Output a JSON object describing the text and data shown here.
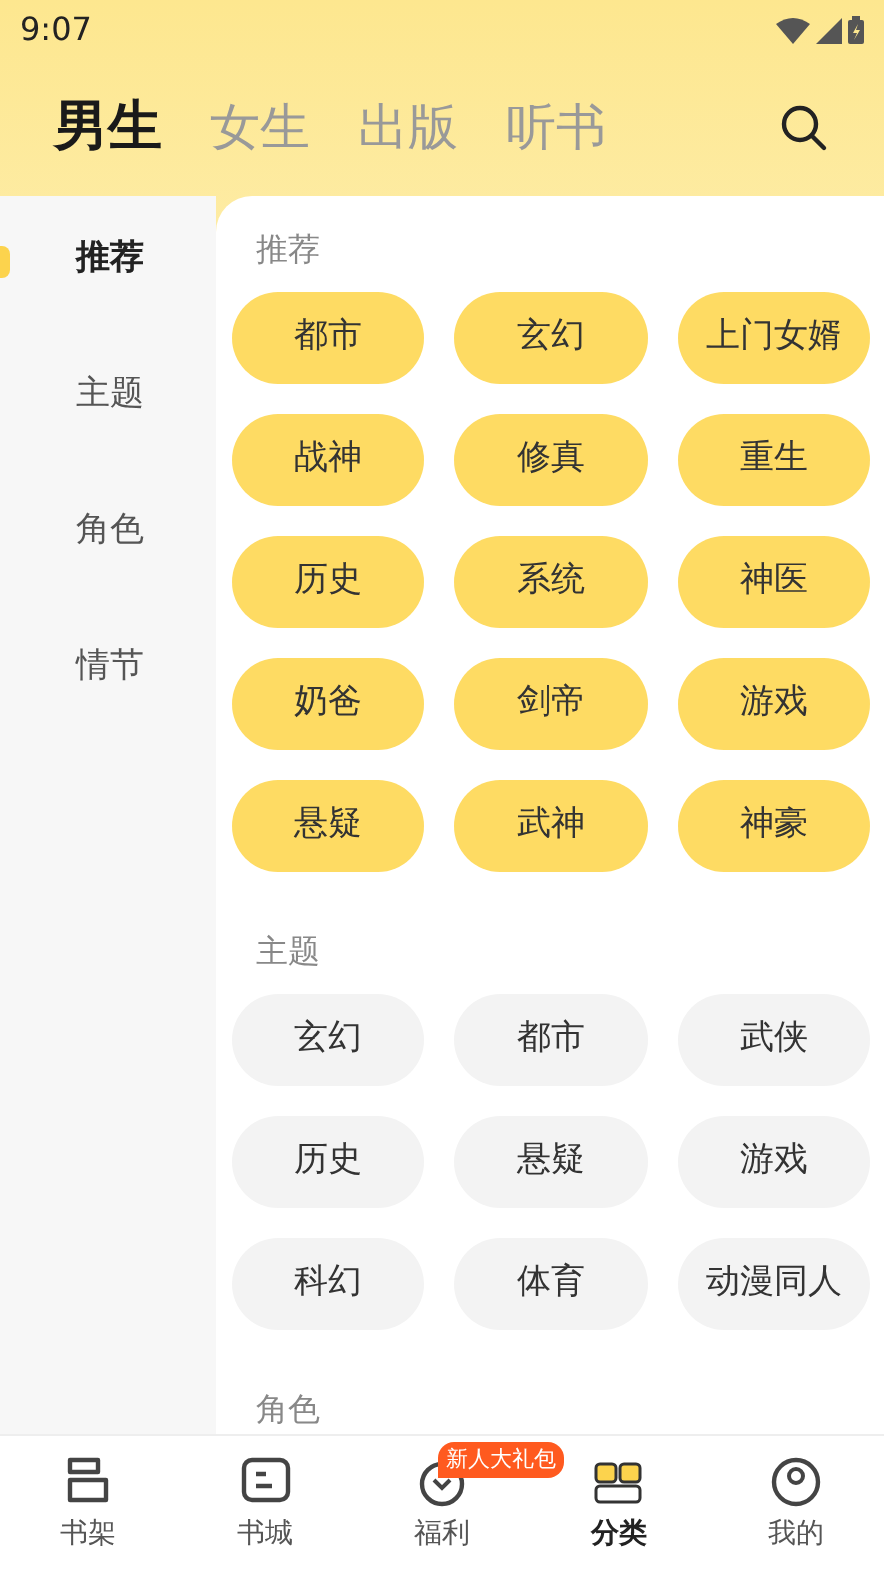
{
  "status_bar": {
    "time": "9:07"
  },
  "top_tabs": [
    {
      "label": "男生",
      "selected": true
    },
    {
      "label": "女生",
      "selected": false
    },
    {
      "label": "出版",
      "selected": false
    },
    {
      "label": "听书",
      "selected": false
    }
  ],
  "sidebar": {
    "items": [
      {
        "label": "推荐",
        "selected": true
      },
      {
        "label": "主题",
        "selected": false
      },
      {
        "label": "角色",
        "selected": false
      },
      {
        "label": "情节",
        "selected": false
      }
    ]
  },
  "sections": [
    {
      "title": "推荐",
      "highlighted": true,
      "tags": [
        "都市",
        "玄幻",
        "上门女婿",
        "战神",
        "修真",
        "重生",
        "历史",
        "系统",
        "神医",
        "奶爸",
        "剑帝",
        "游戏",
        "悬疑",
        "武神",
        "神豪"
      ]
    },
    {
      "title": "主题",
      "highlighted": false,
      "tags": [
        "玄幻",
        "都市",
        "武侠",
        "历史",
        "悬疑",
        "游戏",
        "科幻",
        "体育",
        "动漫同人"
      ]
    },
    {
      "title": "角色"
    }
  ],
  "bottom_nav": [
    {
      "label": "书架",
      "selected": false
    },
    {
      "label": "书城",
      "selected": false
    },
    {
      "label": "福利",
      "selected": false,
      "badge": "新人大礼包"
    },
    {
      "label": "分类",
      "selected": true
    },
    {
      "label": "我的",
      "selected": false
    }
  ]
}
